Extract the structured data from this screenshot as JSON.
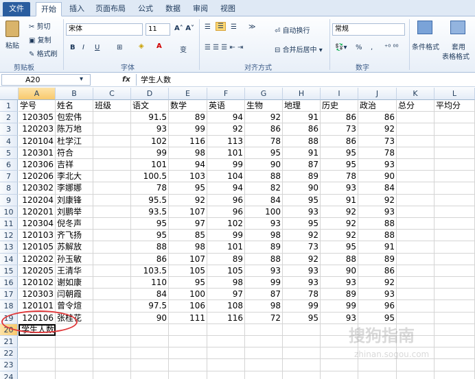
{
  "tabs": [
    "文件",
    "开始",
    "插入",
    "页面布局",
    "公式",
    "数据",
    "审阅",
    "视图"
  ],
  "ribbon": {
    "paste": "粘贴",
    "cut": "剪切",
    "copy": "复制",
    "format_painter": "格式刷",
    "clipboard_group": "剪贴板",
    "font_name": "宋体",
    "font_size": "11",
    "font_group": "字体",
    "wrap_text": "自动换行",
    "merge_center": "合并后居中",
    "align_group": "对齐方式",
    "number_format": "常规",
    "number_group": "数字",
    "cond_format": "条件格式",
    "table_format_1": "套用",
    "table_format_2": "表格格式",
    "bold": "B",
    "italic": "I",
    "underline": "U",
    "percent": "%",
    "comma": ","
  },
  "formula_bar": {
    "name_box": "A20",
    "fx": "fx",
    "content": "学生人数"
  },
  "columns": [
    "A",
    "B",
    "C",
    "D",
    "E",
    "F",
    "G",
    "H",
    "I",
    "J",
    "K",
    "L"
  ],
  "rows": [
    [
      "学号",
      "姓名",
      "班级",
      "语文",
      "数学",
      "英语",
      "生物",
      "地理",
      "历史",
      "政治",
      "总分",
      "平均分"
    ],
    [
      "120305",
      "包宏伟",
      "",
      "91.5",
      "89",
      "94",
      "92",
      "91",
      "86",
      "86",
      "",
      ""
    ],
    [
      "120203",
      "陈万地",
      "",
      "93",
      "99",
      "92",
      "86",
      "86",
      "73",
      "92",
      "",
      ""
    ],
    [
      "120104",
      "杜学江",
      "",
      "102",
      "116",
      "113",
      "78",
      "88",
      "86",
      "73",
      "",
      ""
    ],
    [
      "120301",
      "符合",
      "",
      "99",
      "98",
      "101",
      "95",
      "91",
      "95",
      "78",
      "",
      ""
    ],
    [
      "120306",
      "吉祥",
      "",
      "101",
      "94",
      "99",
      "90",
      "87",
      "95",
      "93",
      "",
      ""
    ],
    [
      "120206",
      "李北大",
      "",
      "100.5",
      "103",
      "104",
      "88",
      "89",
      "78",
      "90",
      "",
      ""
    ],
    [
      "120302",
      "李娜娜",
      "",
      "78",
      "95",
      "94",
      "82",
      "90",
      "93",
      "84",
      "",
      ""
    ],
    [
      "120204",
      "刘康锋",
      "",
      "95.5",
      "92",
      "96",
      "84",
      "95",
      "91",
      "92",
      "",
      ""
    ],
    [
      "120201",
      "刘鹏举",
      "",
      "93.5",
      "107",
      "96",
      "100",
      "93",
      "92",
      "93",
      "",
      ""
    ],
    [
      "120304",
      "倪冬声",
      "",
      "95",
      "97",
      "102",
      "93",
      "95",
      "92",
      "88",
      "",
      ""
    ],
    [
      "120103",
      "齐飞扬",
      "",
      "95",
      "85",
      "99",
      "98",
      "92",
      "92",
      "88",
      "",
      ""
    ],
    [
      "120105",
      "苏解放",
      "",
      "88",
      "98",
      "101",
      "89",
      "73",
      "95",
      "91",
      "",
      ""
    ],
    [
      "120202",
      "孙玉敏",
      "",
      "86",
      "107",
      "89",
      "88",
      "92",
      "88",
      "89",
      "",
      ""
    ],
    [
      "120205",
      "王清华",
      "",
      "103.5",
      "105",
      "105",
      "93",
      "93",
      "90",
      "86",
      "",
      ""
    ],
    [
      "120102",
      "谢如康",
      "",
      "110",
      "95",
      "98",
      "99",
      "93",
      "93",
      "92",
      "",
      ""
    ],
    [
      "120303",
      "闫朝霞",
      "",
      "84",
      "100",
      "97",
      "87",
      "78",
      "89",
      "93",
      "",
      ""
    ],
    [
      "120101",
      "曾令煊",
      "",
      "97.5",
      "106",
      "108",
      "98",
      "99",
      "99",
      "96",
      "",
      ""
    ],
    [
      "120106",
      "张桂花",
      "",
      "90",
      "111",
      "116",
      "72",
      "95",
      "93",
      "95",
      "",
      ""
    ],
    [
      "学生人数",
      "",
      "",
      "",
      "",
      "",
      "",
      "",
      "",
      "",
      "",
      ""
    ],
    [
      "",
      "",
      "",
      "",
      "",
      "",
      "",
      "",
      "",
      "",
      "",
      ""
    ],
    [
      "",
      "",
      "",
      "",
      "",
      "",
      "",
      "",
      "",
      "",
      "",
      ""
    ],
    [
      "",
      "",
      "",
      "",
      "",
      "",
      "",
      "",
      "",
      "",
      "",
      ""
    ],
    [
      "",
      "",
      "",
      "",
      "",
      "",
      "",
      "",
      "",
      "",
      "",
      ""
    ]
  ],
  "watermark": {
    "line1": "搜狗指南",
    "line2": "zhinan.sogou.com"
  },
  "colors": {
    "file_tab": "#2a5d9f",
    "highlight": "#e0383a",
    "selection": "#f8c96d"
  }
}
